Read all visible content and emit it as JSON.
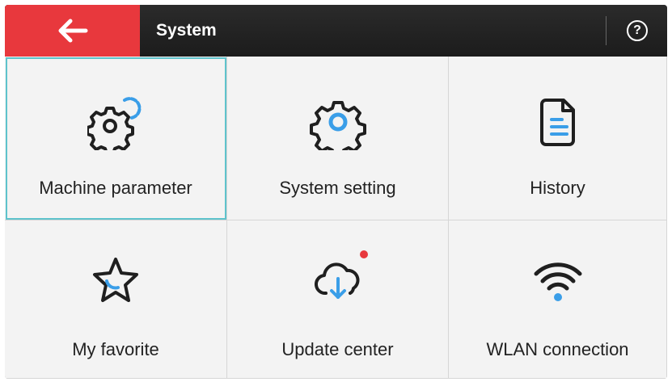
{
  "header": {
    "back_icon": "arrow-left-icon",
    "title": "System",
    "help_label": "?",
    "accent_color": "#e8383d"
  },
  "tiles": [
    {
      "label": "Machine parameter",
      "icon": "gears-icon",
      "selected": true
    },
    {
      "label": "System setting",
      "icon": "gear-icon"
    },
    {
      "label": "History",
      "icon": "document-icon"
    },
    {
      "label": "My favorite",
      "icon": "star-icon"
    },
    {
      "label": "Update center",
      "icon": "cloud-download-icon",
      "badge": true
    },
    {
      "label": "WLAN connection",
      "icon": "wifi-icon"
    }
  ],
  "colors": {
    "icon_dark": "#1f1f1f",
    "icon_blue": "#3a9ee8",
    "selected_outline": "#5ec3cc"
  }
}
